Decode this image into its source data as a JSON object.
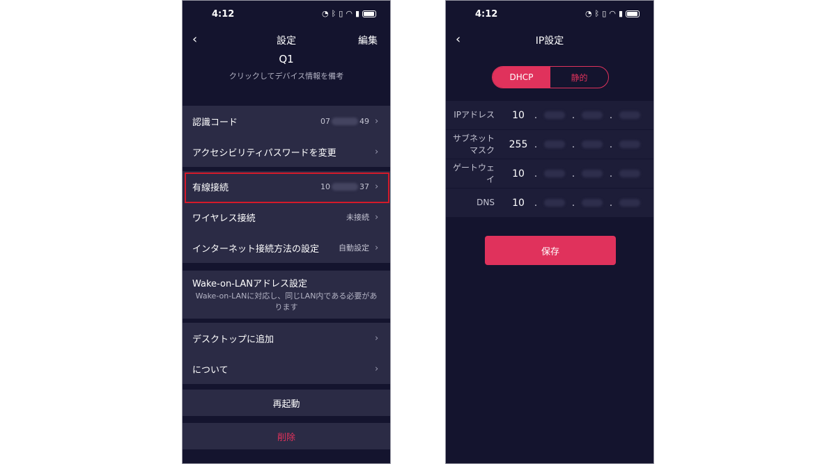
{
  "left": {
    "status": {
      "time": "4:12"
    },
    "nav": {
      "back_icon": "‹",
      "title": "設定",
      "edit_label": "編集"
    },
    "device": {
      "name": "Q1",
      "subtitle": "クリックしてデバイス情報を備考"
    },
    "group1": {
      "id_code_label": "認識コード",
      "id_code_prefix": "07",
      "id_code_suffix": "49",
      "password_label": "アクセシビリティパスワードを変更"
    },
    "group2": {
      "wired_label": "有線接続",
      "wired_prefix": "10",
      "wired_suffix": "37",
      "wireless_label": "ワイヤレス接続",
      "wireless_value": "未接続",
      "internet_label": "インターネット接続方法の設定",
      "internet_value": "自動設定"
    },
    "wol": {
      "title": "Wake-on-LANアドレス設定",
      "desc": "Wake-on-LANに対応し、同じLAN内である必要があります"
    },
    "group3": {
      "desktop_label": "デスクトップに追加",
      "about_label": "について"
    },
    "reboot_label": "再起動",
    "delete_label": "削除"
  },
  "right": {
    "status": {
      "time": "4:12"
    },
    "nav": {
      "back_icon": "‹",
      "title": "IP設定"
    },
    "segment": {
      "dhcp": "DHCP",
      "static": "静的"
    },
    "ip_rows": [
      {
        "label": "IPアドレス",
        "first": "10"
      },
      {
        "label": "サブネットマスク",
        "first": "255"
      },
      {
        "label": "ゲートウェイ",
        "first": "10"
      },
      {
        "label": "DNS",
        "first": "10"
      }
    ],
    "ip_dot": ".",
    "save_label": "保存"
  },
  "colors": {
    "background": "#14142e",
    "card": "#2b2b45",
    "accent": "#e0325c",
    "highlight": "#d41a2a"
  },
  "icons": {
    "chevron": "›"
  }
}
